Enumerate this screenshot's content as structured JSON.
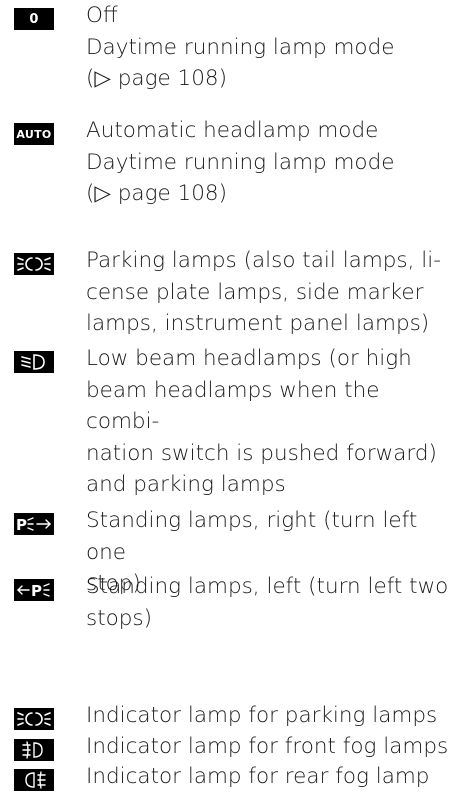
{
  "entries": [
    {
      "symbol": "0",
      "icon": "zero-badge",
      "text": "Off\nDaytime running lamp mode\n(▷ page 108)"
    },
    {
      "symbol": "AUTO",
      "icon": "auto-badge",
      "text": "Automatic headlamp mode\nDaytime running lamp mode\n(▷ page 108)"
    },
    {
      "symbol": "",
      "icon": "parking-lamps-icon",
      "text": "Parking lamps (also tail lamps, li-\ncense plate lamps, side marker\nlamps, instrument panel lamps)"
    },
    {
      "symbol": "",
      "icon": "low-beam-icon",
      "text": "Low beam headlamps (or high\nbeam headlamps when the combi-\nnation switch is pushed forward)\nand parking lamps"
    },
    {
      "symbol": "",
      "icon": "standing-lamps-right-icon",
      "text": "Standing lamps, right (turn left one\nstop)"
    },
    {
      "symbol": "",
      "icon": "standing-lamps-left-icon",
      "text": "Standing lamps, left (turn left two\nstops)"
    },
    {
      "symbol": "",
      "icon": "parking-lamps-indicator-icon",
      "text": "Indicator lamp for parking lamps"
    },
    {
      "symbol": "",
      "icon": "front-fog-lamp-icon",
      "text": "Indicator lamp for front fog lamps"
    },
    {
      "symbol": "",
      "icon": "rear-fog-lamp-icon",
      "text": "Indicator lamp for rear fog lamp"
    }
  ]
}
